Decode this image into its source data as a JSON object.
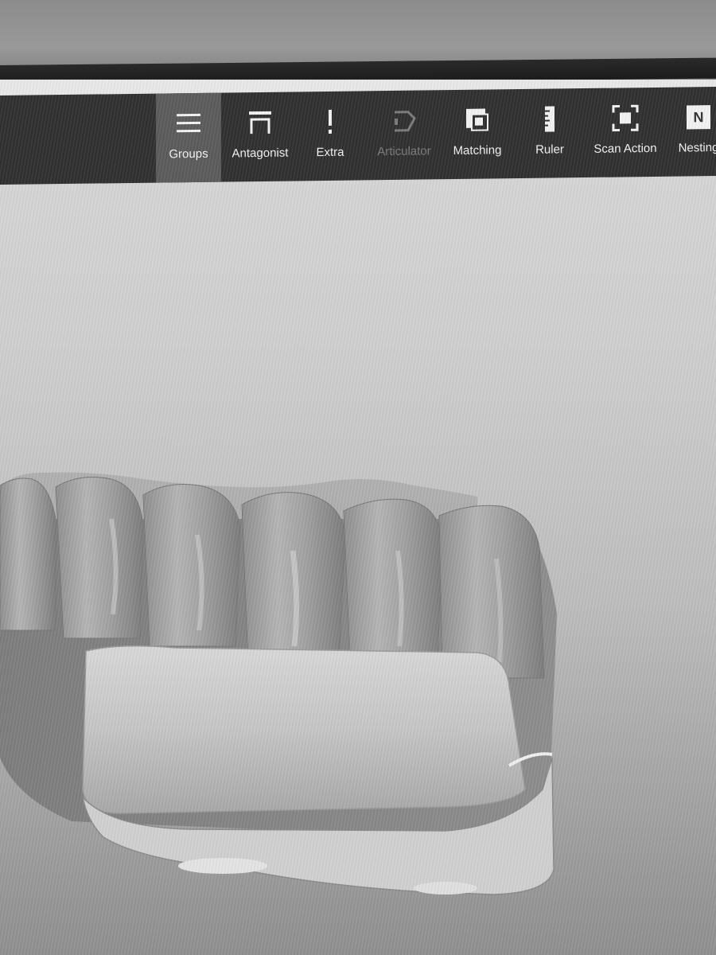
{
  "toolbar": {
    "tools": [
      {
        "label": "Groups",
        "icon": "groups-icon",
        "state": "active"
      },
      {
        "label": "Antagonist",
        "icon": "antagonist-icon",
        "state": "normal"
      },
      {
        "label": "Extra",
        "icon": "extra-icon",
        "state": "normal"
      },
      {
        "label": "Articulator",
        "icon": "articulator-icon",
        "state": "disabled"
      },
      {
        "label": "Matching",
        "icon": "matching-icon",
        "state": "normal"
      },
      {
        "label": "Ruler",
        "icon": "ruler-icon",
        "state": "normal"
      },
      {
        "label": "Scan Action",
        "icon": "scan-action-icon",
        "state": "normal"
      },
      {
        "label": "Nesting",
        "icon": "nesting-icon",
        "icon_text": "N",
        "state": "normal"
      }
    ]
  },
  "viewport": {
    "content": "dental-jaw-model"
  }
}
